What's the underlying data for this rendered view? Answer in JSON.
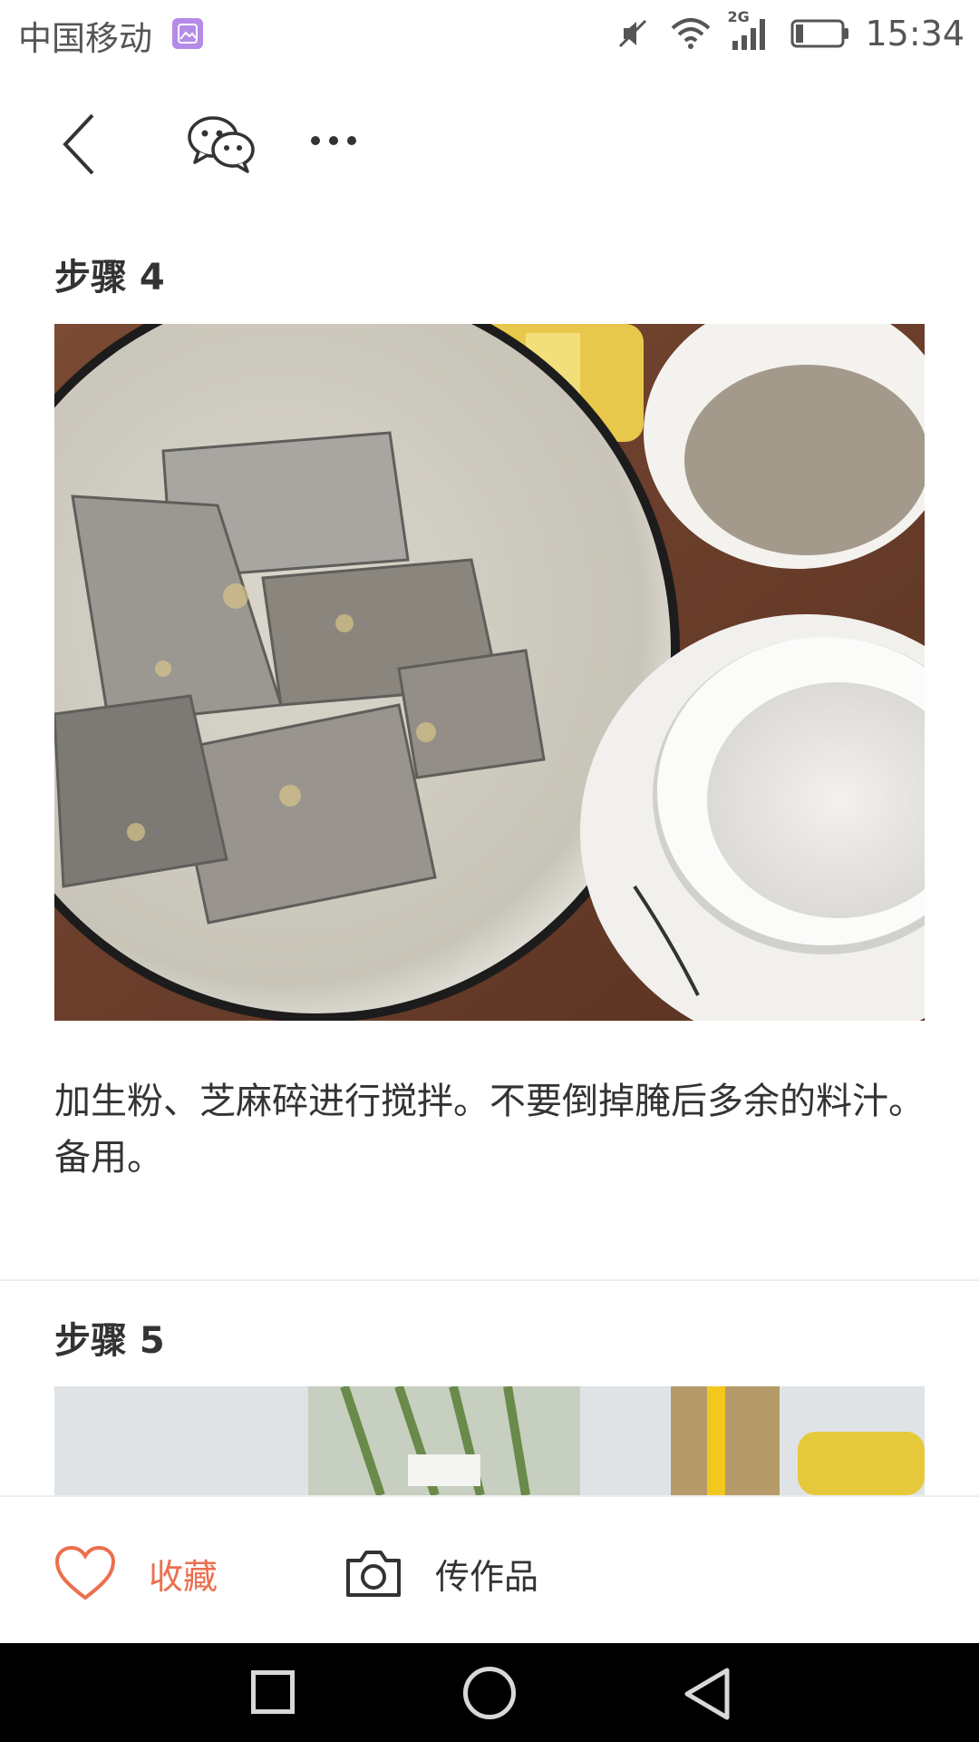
{
  "status_bar": {
    "carrier": "中国移动",
    "network": "2G",
    "time": "15:34",
    "icons": [
      "gallery-notification-icon",
      "mute-icon",
      "wifi-icon",
      "signal-icon",
      "battery-icon"
    ]
  },
  "header": {
    "icons": [
      "back-arrow-icon",
      "wechat-icon",
      "more-icon"
    ]
  },
  "steps": [
    {
      "title": "步骤 4",
      "description": "加生粉、芝麻碎进行搅拌。不要倒掉腌后多余的料汁。备用。"
    },
    {
      "title": "步骤 5",
      "description": ""
    }
  ],
  "action_bar": {
    "favorite_label": "收藏",
    "upload_label": "传作品",
    "favorite_icon": "heart-icon",
    "upload_icon": "camera-icon"
  },
  "colors": {
    "accent": "#ec6f4e",
    "text": "#333333",
    "divider": "#eeeeee"
  }
}
